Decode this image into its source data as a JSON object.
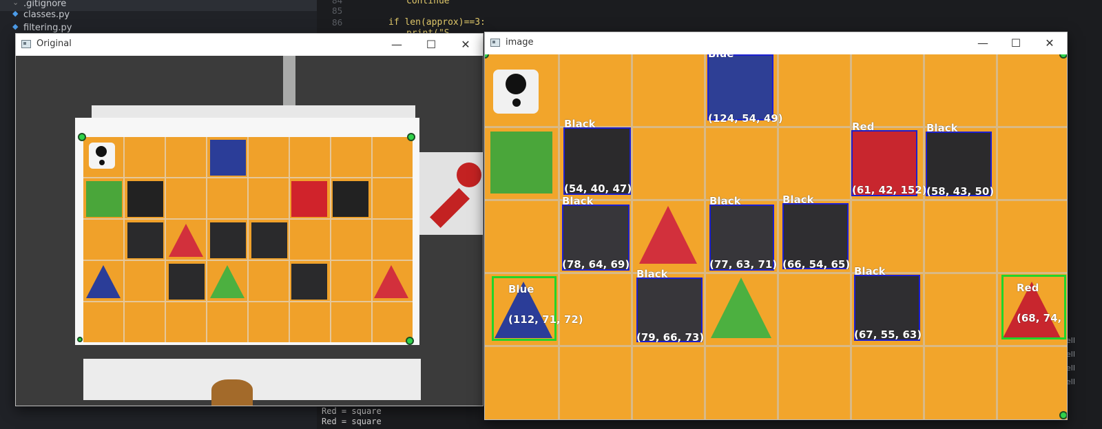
{
  "explorer": {
    "selected": ".gitignore",
    "files": [
      "classes.py",
      "filtering.py"
    ]
  },
  "editor": {
    "line_numbers": [
      "84",
      "85",
      "86"
    ],
    "code_line_1": "continue",
    "code_line_2": "if len(approx)==3:",
    "code_line_3": "print(\"S...",
    "terminal_lines": [
      "Red = square",
      "Red = square"
    ],
    "side_words": [
      "ell",
      "ell",
      "ell",
      "ell"
    ]
  },
  "window_original": {
    "title": "Original",
    "minimize": "—",
    "maximize": "☐",
    "close": "✕"
  },
  "window_image": {
    "title": "image",
    "minimize": "—",
    "maximize": "☐",
    "close": "✕",
    "detections": [
      {
        "name": "Blue",
        "rgb": "(124, 54, 49)"
      },
      {
        "name": "Black",
        "rgb": "(54, 40, 47)"
      },
      {
        "name": "Red",
        "rgb": "(61, 42, 152)"
      },
      {
        "name": "Black",
        "rgb": "(58, 43, 50)"
      },
      {
        "name": "Black",
        "rgb": "(78, 64, 69)"
      },
      {
        "name": "Black",
        "rgb": "(77, 63, 71)"
      },
      {
        "name": "Black",
        "rgb": "(66, 54, 65)"
      },
      {
        "name": "Blue",
        "rgb": "(112, 71, 72)"
      },
      {
        "name": "Black",
        "rgb": "(79, 66, 73)"
      },
      {
        "name": "Black",
        "rgb": "(67, 55, 63)"
      },
      {
        "name": "Red",
        "rgb": "(68, 74,"
      }
    ]
  },
  "colors": {
    "board_orange": "#f0a12a",
    "detect_blue": "#1c1fd1",
    "detect_green": "#20d42a",
    "shape_red": "#c8262e",
    "shape_green": "#4aa63a",
    "shape_blue": "#2b3d98",
    "shape_black": "#2a2a2c"
  }
}
